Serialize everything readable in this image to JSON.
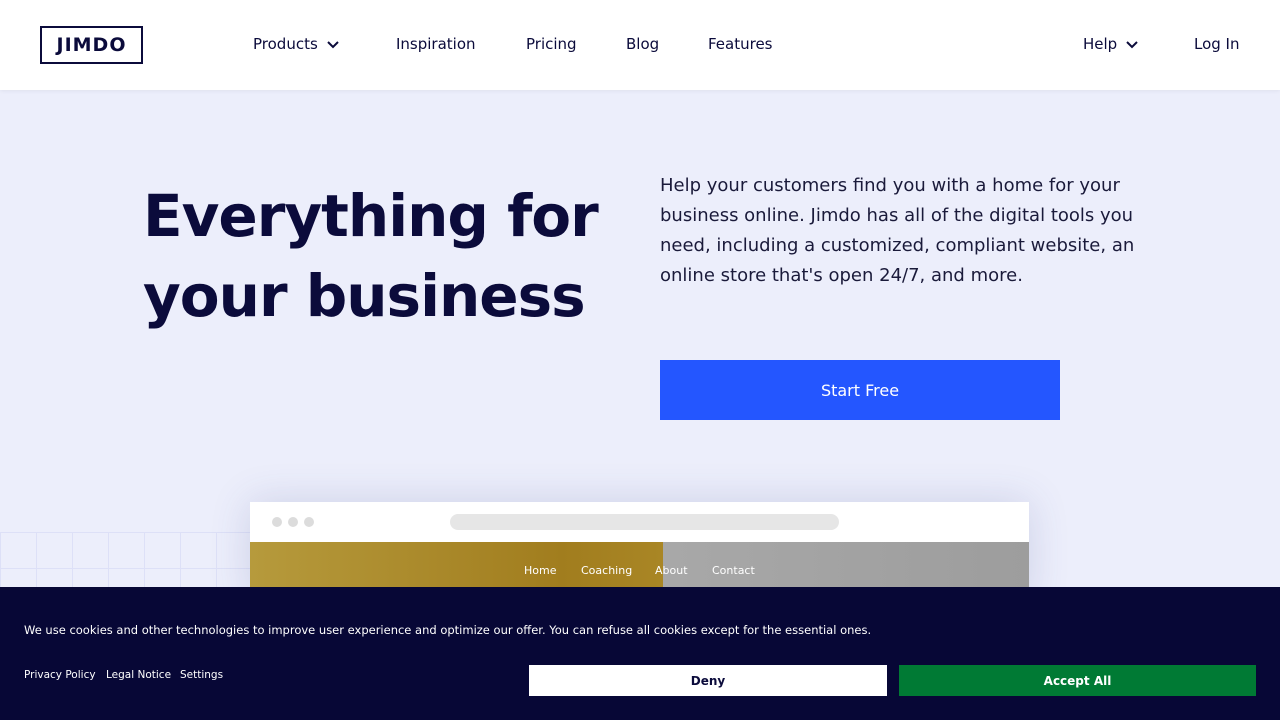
{
  "header": {
    "logo": "JIMDO",
    "nav": {
      "products": "Products",
      "inspiration": "Inspiration",
      "pricing": "Pricing",
      "blog": "Blog",
      "features": "Features",
      "help": "Help",
      "login": "Log In"
    }
  },
  "hero": {
    "title": "Everything for your business",
    "description": "Help your customers find you with a home for your business online. Jimdo has all of the digital tools you need, including a customized, compliant website, an online store that's open 24/7, and more.",
    "cta_label": "Start Free"
  },
  "mockup": {
    "links": [
      "Home",
      "Coaching",
      "About",
      "Contact"
    ]
  },
  "cookie_banner": {
    "text": "We use cookies and other technologies to improve user experience and optimize our offer. You can refuse all cookies except for the essential ones.",
    "links": {
      "privacy": "Privacy Policy",
      "legal": "Legal Notice",
      "settings": "Settings"
    },
    "deny_label": "Deny",
    "accept_label": "Accept All"
  },
  "colors": {
    "brand_navy": "#0b0b3b",
    "primary_blue": "#2456ff",
    "hero_background": "#eceefb",
    "banner_background": "#070736",
    "accept_green": "#007a34"
  }
}
